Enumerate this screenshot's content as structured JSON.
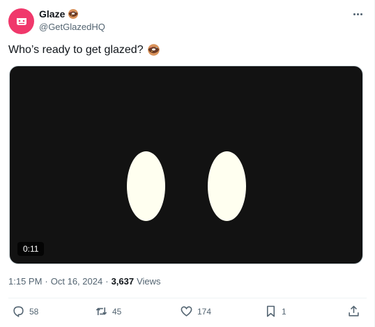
{
  "author": {
    "display_name": "Glaze",
    "handle": "@GetGlazedHQ",
    "name_emoji": "donut-emoji",
    "avatar_color": "#f0386b"
  },
  "tweet": {
    "text": "Who’s ready to get glazed?",
    "text_emoji": "donut-emoji"
  },
  "media": {
    "type": "video",
    "duration": "0:11",
    "background": "#121212",
    "eye_color": "#fffff0"
  },
  "meta": {
    "time": "1:15 PM",
    "sep1": "·",
    "date": "Oct 16, 2024",
    "sep2": "·",
    "views_count": "3,637",
    "views_label": "Views"
  },
  "actions": {
    "reply": {
      "icon": "reply-icon",
      "count": "58"
    },
    "retweet": {
      "icon": "retweet-icon",
      "count": "45"
    },
    "like": {
      "icon": "like-icon",
      "count": "174"
    },
    "bookmark": {
      "icon": "bookmark-icon",
      "count": "1"
    },
    "share": {
      "icon": "share-icon",
      "count": ""
    }
  }
}
